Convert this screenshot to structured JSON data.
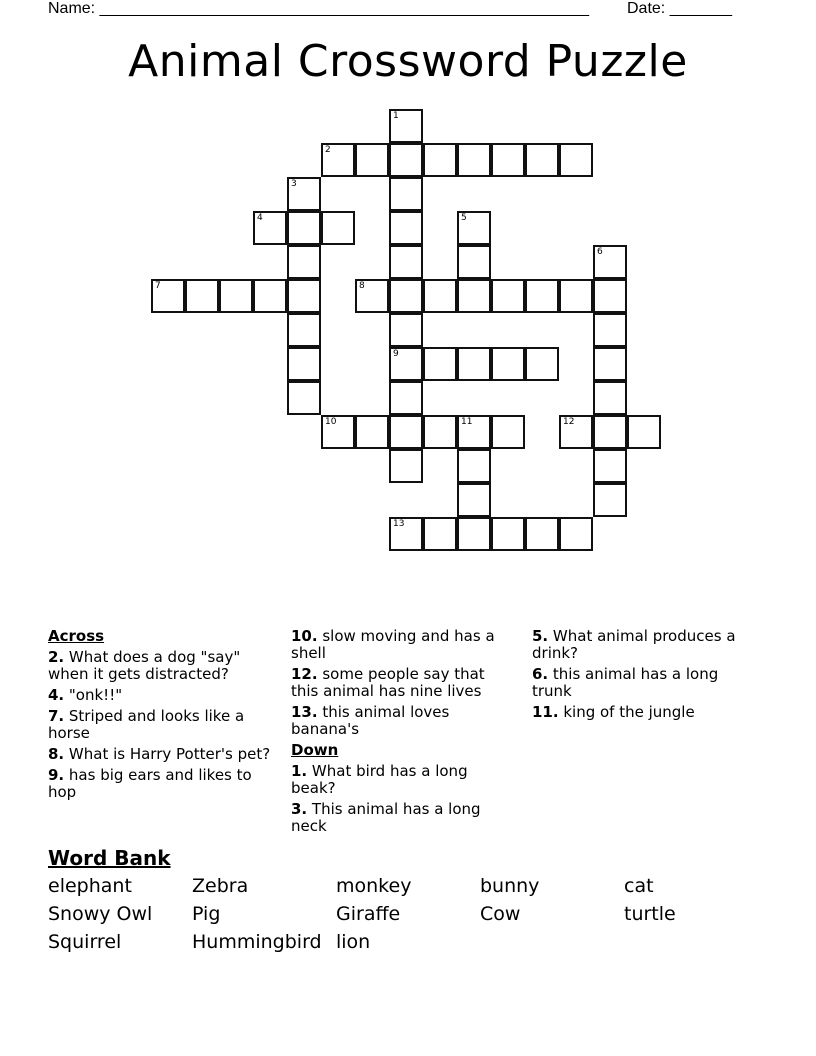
{
  "header": {
    "name_label": "Name: _______________________________________________________",
    "date_label": "Date: _______"
  },
  "title": "Animal Crossword Puzzle",
  "grid": {
    "words": [
      {
        "number": 1,
        "direction": "down",
        "row": 0,
        "col": 7,
        "length": 11
      },
      {
        "number": 2,
        "direction": "across",
        "row": 1,
        "col": 5,
        "length": 8
      },
      {
        "number": 3,
        "direction": "down",
        "row": 2,
        "col": 4,
        "length": 7
      },
      {
        "number": 4,
        "direction": "across",
        "row": 3,
        "col": 3,
        "length": 3
      },
      {
        "number": 5,
        "direction": "down",
        "row": 3,
        "col": 9,
        "length": 3
      },
      {
        "number": 6,
        "direction": "down",
        "row": 4,
        "col": 13,
        "length": 8
      },
      {
        "number": 7,
        "direction": "across",
        "row": 5,
        "col": 0,
        "length": 5
      },
      {
        "number": 8,
        "direction": "across",
        "row": 5,
        "col": 6,
        "length": 8
      },
      {
        "number": 9,
        "direction": "across",
        "row": 7,
        "col": 7,
        "length": 5
      },
      {
        "number": 10,
        "direction": "across",
        "row": 9,
        "col": 5,
        "length": 6
      },
      {
        "number": 11,
        "direction": "down",
        "row": 9,
        "col": 9,
        "length": 4
      },
      {
        "number": 12,
        "direction": "across",
        "row": 9,
        "col": 12,
        "length": 3
      },
      {
        "number": 13,
        "direction": "across",
        "row": 12,
        "col": 7,
        "length": 6
      }
    ]
  },
  "clues": {
    "across_heading": "Across",
    "down_heading": "Down",
    "across": [
      {
        "num": "2",
        "text": "What does a dog \"say\" when it gets distracted?"
      },
      {
        "num": "4",
        "text": "\"onk!!\""
      },
      {
        "num": "7",
        "text": "Striped and looks like a horse"
      },
      {
        "num": "8",
        "text": "What is Harry Potter's pet?"
      },
      {
        "num": "9",
        "text": "has big ears and likes to hop"
      },
      {
        "num": "10",
        "text": "slow moving and has a shell"
      },
      {
        "num": "12",
        "text": "some people say that this animal has nine lives"
      },
      {
        "num": "13",
        "text": "this animal loves banana's"
      }
    ],
    "down": [
      {
        "num": "1",
        "text": "What bird has a long beak?"
      },
      {
        "num": "3",
        "text": "This animal has a long neck"
      },
      {
        "num": "5",
        "text": "What animal produces a drink?"
      },
      {
        "num": "6",
        "text": "this animal has a long trunk"
      },
      {
        "num": "11",
        "text": "king of the jungle"
      }
    ]
  },
  "word_bank": {
    "title": "Word Bank",
    "rows": [
      [
        "elephant",
        "Zebra",
        "monkey",
        "bunny",
        "cat"
      ],
      [
        "Snowy Owl",
        "Pig",
        "Giraffe",
        "Cow",
        "turtle"
      ],
      [
        "Squirrel",
        "Hummingbird",
        "lion"
      ]
    ]
  }
}
